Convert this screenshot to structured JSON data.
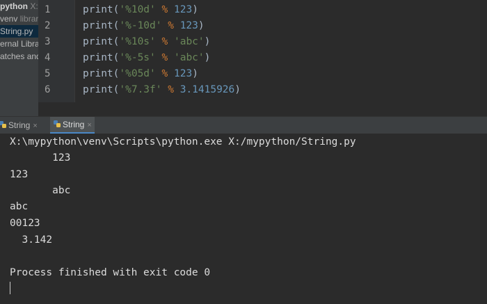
{
  "project": {
    "root_name": "python",
    "root_path": "X:",
    "venv_label": "venv",
    "venv_suffix": "librar",
    "file_name": "String.py",
    "external_libraries": "ernal Librar",
    "scratches": "atches and"
  },
  "editor": {
    "lines": [
      {
        "num": "1",
        "func": "print(",
        "fmt": "'%10d'",
        "op": " % ",
        "arg": "123",
        "end": ")"
      },
      {
        "num": "2",
        "func": "print(",
        "fmt": "'%-10d'",
        "op": " % ",
        "arg": "123",
        "end": ")"
      },
      {
        "num": "3",
        "func": "print(",
        "fmt": "'%10s'",
        "op": " % ",
        "arg": "'abc'",
        "end": ")"
      },
      {
        "num": "4",
        "func": "print(",
        "fmt": "'%-5s'",
        "op": " % ",
        "arg": "'abc'",
        "end": ")"
      },
      {
        "num": "5",
        "func": "print(",
        "fmt": "'%05d'",
        "op": " % ",
        "arg": "123",
        "end": ")"
      },
      {
        "num": "6",
        "func": "print(",
        "fmt": "'%7.3f'",
        "op": " % ",
        "arg": "3.1415926",
        "end": ")"
      }
    ]
  },
  "tabs": [
    {
      "label": "String",
      "close": "×"
    },
    {
      "label": "String",
      "close": "×"
    }
  ],
  "console": {
    "lines": [
      "X:\\mypython\\venv\\Scripts\\python.exe X:/mypython/String.py",
      "       123",
      "123",
      "       abc",
      "abc",
      "00123",
      "  3.142",
      "",
      "Process finished with exit code 0"
    ]
  }
}
